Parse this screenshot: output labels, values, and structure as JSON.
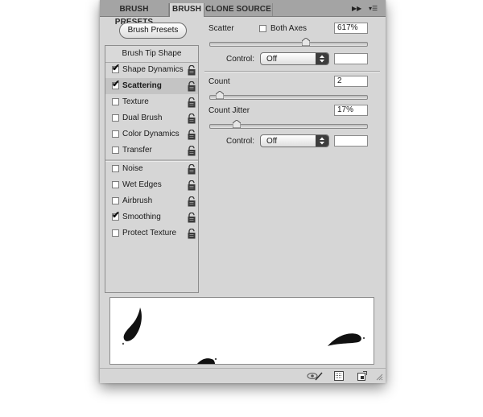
{
  "tabs": [
    {
      "label": "BRUSH PRESETS",
      "active": false
    },
    {
      "label": "BRUSH",
      "active": true
    },
    {
      "label": "CLONE SOURCE",
      "active": false
    }
  ],
  "tab_controls": {
    "collapse_glyph": "▶▶",
    "menu_glyph": "▾☰"
  },
  "brush_presets_button": "Brush Presets",
  "sidebar": {
    "header": "Brush Tip Shape",
    "items": [
      {
        "label": "Shape Dynamics",
        "checked": true,
        "selected": false
      },
      {
        "label": "Scattering",
        "checked": true,
        "selected": true
      },
      {
        "label": "Texture",
        "checked": false,
        "selected": false
      },
      {
        "label": "Dual Brush",
        "checked": false,
        "selected": false
      },
      {
        "label": "Color Dynamics",
        "checked": false,
        "selected": false
      },
      {
        "label": "Transfer",
        "checked": false,
        "selected": false
      },
      {
        "label": "Noise",
        "checked": false,
        "selected": false
      },
      {
        "label": "Wet Edges",
        "checked": false,
        "selected": false
      },
      {
        "label": "Airbrush",
        "checked": false,
        "selected": false
      },
      {
        "label": "Smoothing",
        "checked": true,
        "selected": false
      },
      {
        "label": "Protect Texture",
        "checked": false,
        "selected": false
      }
    ]
  },
  "scatter": {
    "label": "Scatter",
    "both_axes_label": "Both Axes",
    "both_axes_checked": false,
    "value": "617%",
    "slider_fraction": 0.617,
    "control_label": "Control:",
    "control_value": "Off",
    "control_extra": ""
  },
  "count": {
    "label": "Count",
    "value": "2",
    "slider_fraction": 0.06
  },
  "count_jitter": {
    "label": "Count Jitter",
    "value": "17%",
    "slider_fraction": 0.17,
    "control_label": "Control:",
    "control_value": "Off",
    "control_extra": ""
  },
  "footer_icons": [
    "eye-brush-icon",
    "grid-icon",
    "new-preset-icon",
    "resize-grip-icon"
  ],
  "colors": {
    "panel_bg": "#d6d6d6",
    "tab_bar": "#a4a4a4",
    "selected_row": "#c4c4c4"
  }
}
